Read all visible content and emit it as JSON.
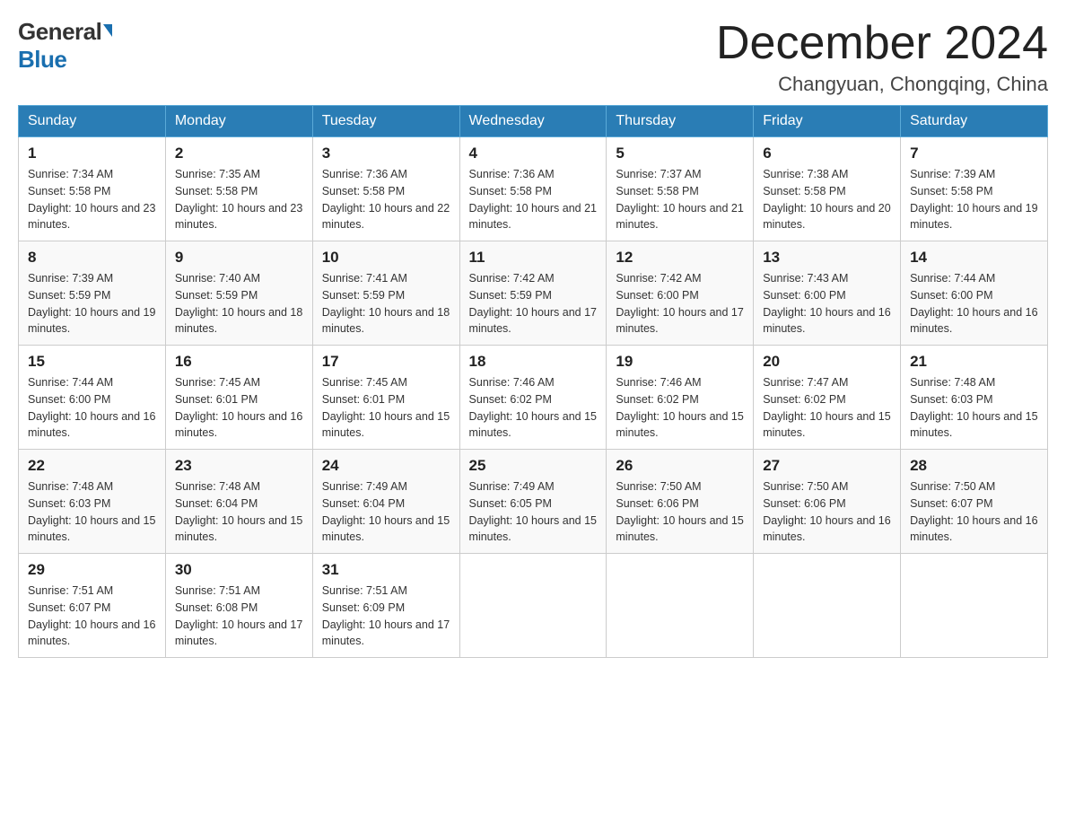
{
  "logo": {
    "general": "General",
    "blue": "Blue"
  },
  "title": {
    "month_year": "December 2024",
    "location": "Changyuan, Chongqing, China"
  },
  "headers": [
    "Sunday",
    "Monday",
    "Tuesday",
    "Wednesday",
    "Thursday",
    "Friday",
    "Saturday"
  ],
  "weeks": [
    [
      {
        "day": "1",
        "sunrise": "7:34 AM",
        "sunset": "5:58 PM",
        "daylight": "10 hours and 23 minutes."
      },
      {
        "day": "2",
        "sunrise": "7:35 AM",
        "sunset": "5:58 PM",
        "daylight": "10 hours and 23 minutes."
      },
      {
        "day": "3",
        "sunrise": "7:36 AM",
        "sunset": "5:58 PM",
        "daylight": "10 hours and 22 minutes."
      },
      {
        "day": "4",
        "sunrise": "7:36 AM",
        "sunset": "5:58 PM",
        "daylight": "10 hours and 21 minutes."
      },
      {
        "day": "5",
        "sunrise": "7:37 AM",
        "sunset": "5:58 PM",
        "daylight": "10 hours and 21 minutes."
      },
      {
        "day": "6",
        "sunrise": "7:38 AM",
        "sunset": "5:58 PM",
        "daylight": "10 hours and 20 minutes."
      },
      {
        "day": "7",
        "sunrise": "7:39 AM",
        "sunset": "5:58 PM",
        "daylight": "10 hours and 19 minutes."
      }
    ],
    [
      {
        "day": "8",
        "sunrise": "7:39 AM",
        "sunset": "5:59 PM",
        "daylight": "10 hours and 19 minutes."
      },
      {
        "day": "9",
        "sunrise": "7:40 AM",
        "sunset": "5:59 PM",
        "daylight": "10 hours and 18 minutes."
      },
      {
        "day": "10",
        "sunrise": "7:41 AM",
        "sunset": "5:59 PM",
        "daylight": "10 hours and 18 minutes."
      },
      {
        "day": "11",
        "sunrise": "7:42 AM",
        "sunset": "5:59 PM",
        "daylight": "10 hours and 17 minutes."
      },
      {
        "day": "12",
        "sunrise": "7:42 AM",
        "sunset": "6:00 PM",
        "daylight": "10 hours and 17 minutes."
      },
      {
        "day": "13",
        "sunrise": "7:43 AM",
        "sunset": "6:00 PM",
        "daylight": "10 hours and 16 minutes."
      },
      {
        "day": "14",
        "sunrise": "7:44 AM",
        "sunset": "6:00 PM",
        "daylight": "10 hours and 16 minutes."
      }
    ],
    [
      {
        "day": "15",
        "sunrise": "7:44 AM",
        "sunset": "6:00 PM",
        "daylight": "10 hours and 16 minutes."
      },
      {
        "day": "16",
        "sunrise": "7:45 AM",
        "sunset": "6:01 PM",
        "daylight": "10 hours and 16 minutes."
      },
      {
        "day": "17",
        "sunrise": "7:45 AM",
        "sunset": "6:01 PM",
        "daylight": "10 hours and 15 minutes."
      },
      {
        "day": "18",
        "sunrise": "7:46 AM",
        "sunset": "6:02 PM",
        "daylight": "10 hours and 15 minutes."
      },
      {
        "day": "19",
        "sunrise": "7:46 AM",
        "sunset": "6:02 PM",
        "daylight": "10 hours and 15 minutes."
      },
      {
        "day": "20",
        "sunrise": "7:47 AM",
        "sunset": "6:02 PM",
        "daylight": "10 hours and 15 minutes."
      },
      {
        "day": "21",
        "sunrise": "7:48 AM",
        "sunset": "6:03 PM",
        "daylight": "10 hours and 15 minutes."
      }
    ],
    [
      {
        "day": "22",
        "sunrise": "7:48 AM",
        "sunset": "6:03 PM",
        "daylight": "10 hours and 15 minutes."
      },
      {
        "day": "23",
        "sunrise": "7:48 AM",
        "sunset": "6:04 PM",
        "daylight": "10 hours and 15 minutes."
      },
      {
        "day": "24",
        "sunrise": "7:49 AM",
        "sunset": "6:04 PM",
        "daylight": "10 hours and 15 minutes."
      },
      {
        "day": "25",
        "sunrise": "7:49 AM",
        "sunset": "6:05 PM",
        "daylight": "10 hours and 15 minutes."
      },
      {
        "day": "26",
        "sunrise": "7:50 AM",
        "sunset": "6:06 PM",
        "daylight": "10 hours and 15 minutes."
      },
      {
        "day": "27",
        "sunrise": "7:50 AM",
        "sunset": "6:06 PM",
        "daylight": "10 hours and 16 minutes."
      },
      {
        "day": "28",
        "sunrise": "7:50 AM",
        "sunset": "6:07 PM",
        "daylight": "10 hours and 16 minutes."
      }
    ],
    [
      {
        "day": "29",
        "sunrise": "7:51 AM",
        "sunset": "6:07 PM",
        "daylight": "10 hours and 16 minutes."
      },
      {
        "day": "30",
        "sunrise": "7:51 AM",
        "sunset": "6:08 PM",
        "daylight": "10 hours and 17 minutes."
      },
      {
        "day": "31",
        "sunrise": "7:51 AM",
        "sunset": "6:09 PM",
        "daylight": "10 hours and 17 minutes."
      },
      null,
      null,
      null,
      null
    ]
  ]
}
